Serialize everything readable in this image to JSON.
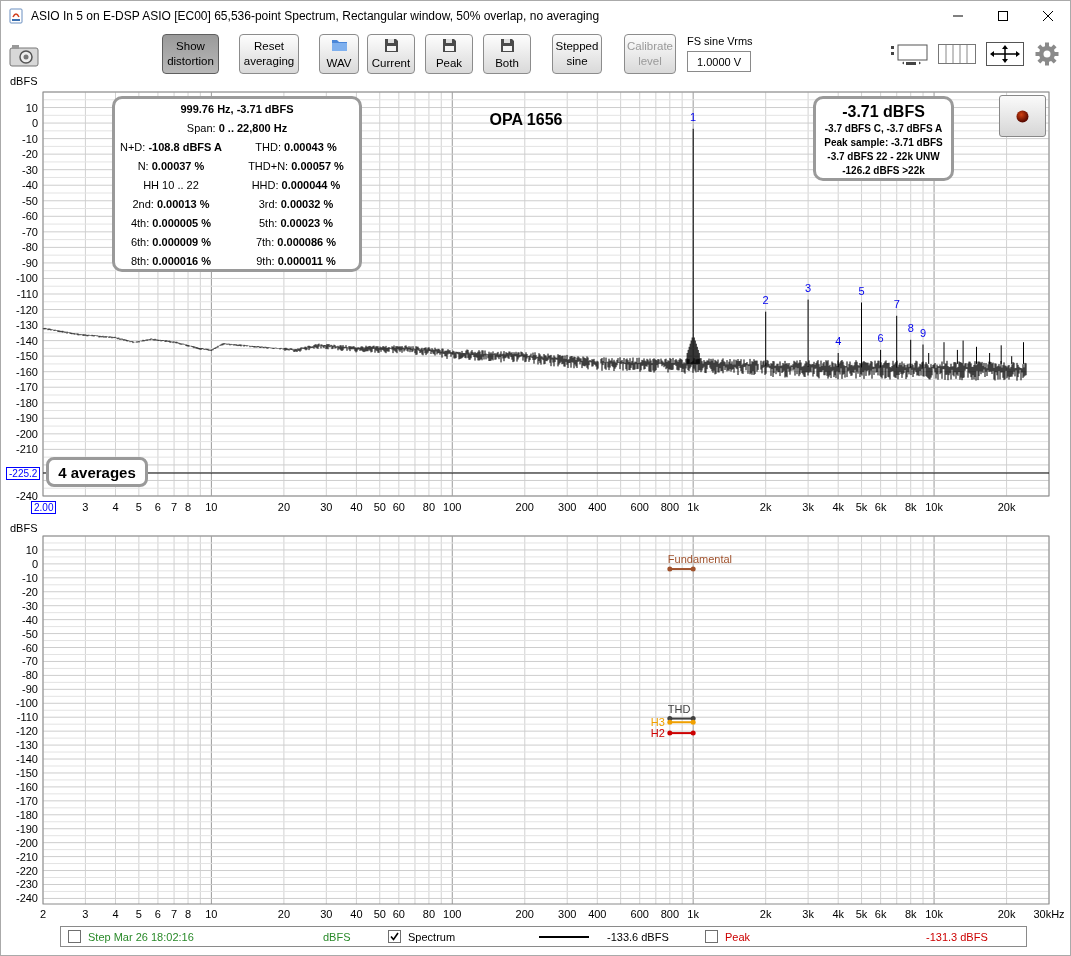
{
  "window": {
    "title": "ASIO In 5 on E-DSP ASIO [EC00] 65,536-point Spectrum, Rectangular window, 50% overlap, no averaging"
  },
  "toolbar": {
    "buttons": [
      {
        "label": "Show\ndistortion",
        "kind": "text",
        "pressed": true,
        "disabled": false
      },
      {
        "label": "Reset\naveraging",
        "kind": "text",
        "pressed": false,
        "disabled": false
      },
      {
        "label": "WAV",
        "kind": "folder",
        "pressed": false,
        "disabled": false
      },
      {
        "label": "Current",
        "kind": "save",
        "pressed": false,
        "disabled": false
      },
      {
        "label": "Peak",
        "kind": "save",
        "pressed": false,
        "disabled": false
      },
      {
        "label": "Both",
        "kind": "save",
        "pressed": false,
        "disabled": false
      },
      {
        "label": "Stepped\nsine",
        "kind": "text",
        "pressed": false,
        "disabled": false
      },
      {
        "label": "Calibrate\nlevel",
        "kind": "text",
        "pressed": false,
        "disabled": true
      }
    ],
    "fs_sine": {
      "label": "FS sine Vrms",
      "value": "1.0000 V"
    }
  },
  "spectrum_plot": {
    "title": "OPA 1656",
    "y_unit": "dBFS",
    "y_axis_labels": [
      "10",
      "0",
      "-10",
      "-20",
      "-30",
      "-40",
      "-50",
      "-60",
      "-70",
      "-80",
      "-90",
      "-100",
      "-110",
      "-120",
      "-130",
      "-140",
      "-150",
      "-160",
      "-170",
      "-180",
      "-190",
      "-200",
      "-210",
      "-240"
    ],
    "x_axis_labels": [
      "3",
      "4",
      "5",
      "6",
      "7",
      "8",
      "10",
      "20",
      "30",
      "40",
      "50",
      "60",
      "80",
      "100",
      "200",
      "300",
      "400",
      "600",
      "800",
      "1k",
      "2k",
      "3k",
      "4k",
      "5k",
      "6k",
      "8k",
      "10k",
      "20k"
    ],
    "peak_labels": [
      "1",
      "2",
      "3",
      "4",
      "5",
      "6",
      "7",
      "8",
      "9"
    ],
    "cursor_readout": "-225.2",
    "x_readout": "2.00",
    "stats": {
      "header": "999.76 Hz, -3.71 dBFS",
      "span": "Span: **0 .. 22,800 Hz**",
      "rows": [
        [
          "N+D: **-108.8 dBFS A**",
          "THD: **0.00043 %**"
        ],
        [
          "N: **0.00037 %**",
          "THD+N: **0.00057 %**"
        ],
        [
          "HH 10 .. 22",
          "HHD: **0.000044 %**"
        ],
        [
          "2nd: **0.00013 %**",
          "3rd: **0.00032 %**"
        ],
        [
          "4th: **0.000005 %**",
          "5th: **0.00023 %**"
        ],
        [
          "6th: **0.000009 %**",
          "7th: **0.000086 %**"
        ],
        [
          "8th: **0.000016 %**",
          "9th: **0.000011 %**"
        ]
      ]
    },
    "level_box": {
      "main": "-3.71 dBFS",
      "lines": [
        "-3.7 dBFS C, -3.7 dBFS A",
        "Peak sample: -3.71 dBFS",
        "-3.7 dBFS 22 - 22k UNW",
        "-126.2 dBFS >22k"
      ]
    },
    "averages": "4 averages"
  },
  "distortion_plot": {
    "y_unit": "dBFS",
    "y_axis_labels": [
      "10",
      "0",
      "-10",
      "-20",
      "-30",
      "-40",
      "-50",
      "-60",
      "-70",
      "-80",
      "-90",
      "-100",
      "-110",
      "-120",
      "-130",
      "-140",
      "-150",
      "-160",
      "-170",
      "-180",
      "-190",
      "-200",
      "-210",
      "-220",
      "-230",
      "-240"
    ],
    "x_axis_labels": [
      "2",
      "3",
      "4",
      "5",
      "6",
      "7",
      "8",
      "10",
      "20",
      "30",
      "40",
      "50",
      "60",
      "80",
      "100",
      "200",
      "300",
      "400",
      "600",
      "800",
      "1k",
      "2k",
      "3k",
      "4k",
      "5k",
      "6k",
      "8k",
      "10k",
      "20k",
      "30kHz"
    ],
    "markers": [
      {
        "label": "Fundamental",
        "color": "#a0522d"
      },
      {
        "label": "THD",
        "color": "#404040"
      },
      {
        "label": "H3",
        "color": "#f0a000"
      },
      {
        "label": "H2",
        "color": "#cc0000"
      }
    ]
  },
  "legend": {
    "items": [
      {
        "kind": "entry",
        "label": "Step Mar 26 18:02:16",
        "checked": false,
        "color": "#2a8a2a"
      },
      {
        "kind": "text",
        "label": "dBFS",
        "color": "#2a8a2a"
      },
      {
        "kind": "entry",
        "label": "Spectrum",
        "checked": true,
        "color": "#000000"
      },
      {
        "kind": "line",
        "color": "#000000"
      },
      {
        "kind": "text",
        "label": "-133.6 dBFS",
        "color": "#000000"
      },
      {
        "kind": "entry",
        "label": "Peak",
        "checked": false,
        "color": "#cc0000"
      },
      {
        "kind": "text",
        "label": "-131.3 dBFS",
        "color": "#cc0000"
      }
    ]
  }
}
